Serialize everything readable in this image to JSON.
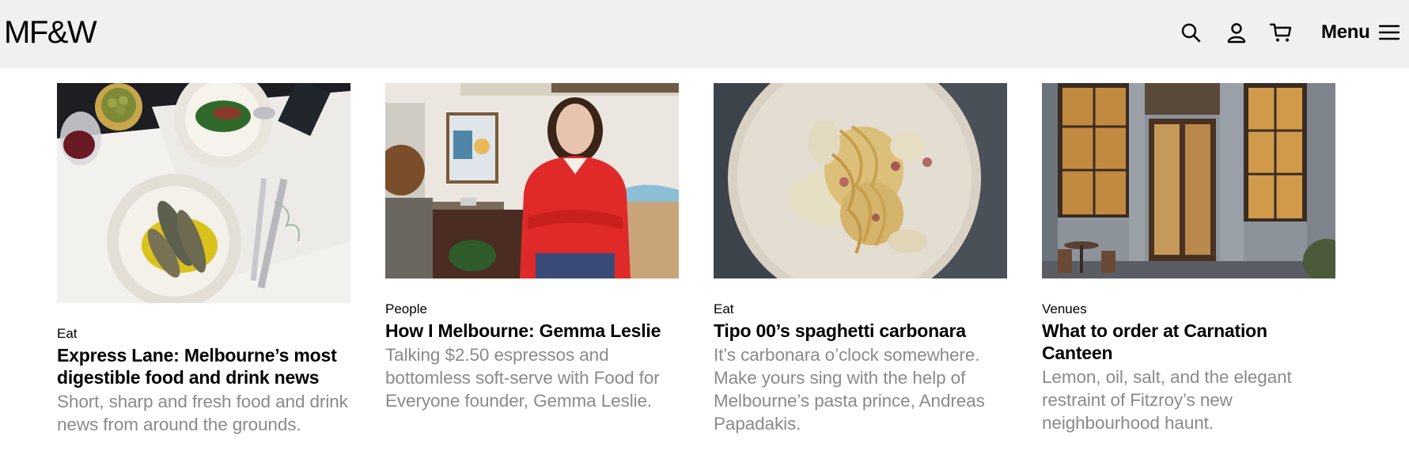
{
  "header": {
    "logo": "MF&W",
    "menu_label": "Menu",
    "icons": [
      "search-icon",
      "account-icon",
      "cart-icon",
      "hamburger-icon"
    ]
  },
  "articles": [
    {
      "category": "Eat",
      "title": "Express Lane: Melbourne’s most digestible food and drink news",
      "description": "Short, sharp and fresh food and drink news from around the grounds.",
      "image": "table of sardines, greens, olives and wine"
    },
    {
      "category": "People",
      "title": "How I Melbourne: Gemma Leslie",
      "description": "Talking $2.50 espressos and bottomless soft-serve with Food for Everyone founder, Gemma Leslie.",
      "image": "woman in red jumper in kitchen"
    },
    {
      "category": "Eat",
      "title": "Tipo 00’s spaghetti carbonara",
      "description": "It’s carbonara o’clock somewhere. Make yours sing with the help of Melbourne’s pasta prince, Andreas Papadakis.",
      "image": "plate of spaghetti carbonara"
    },
    {
      "category": "Venues",
      "title": "What to order at Carnation Canteen",
      "description": "Lemon, oil, salt, and the elegant restraint of Fitzroy’s new neighbourhood haunt.",
      "image": "restaurant shopfront at dusk"
    }
  ]
}
